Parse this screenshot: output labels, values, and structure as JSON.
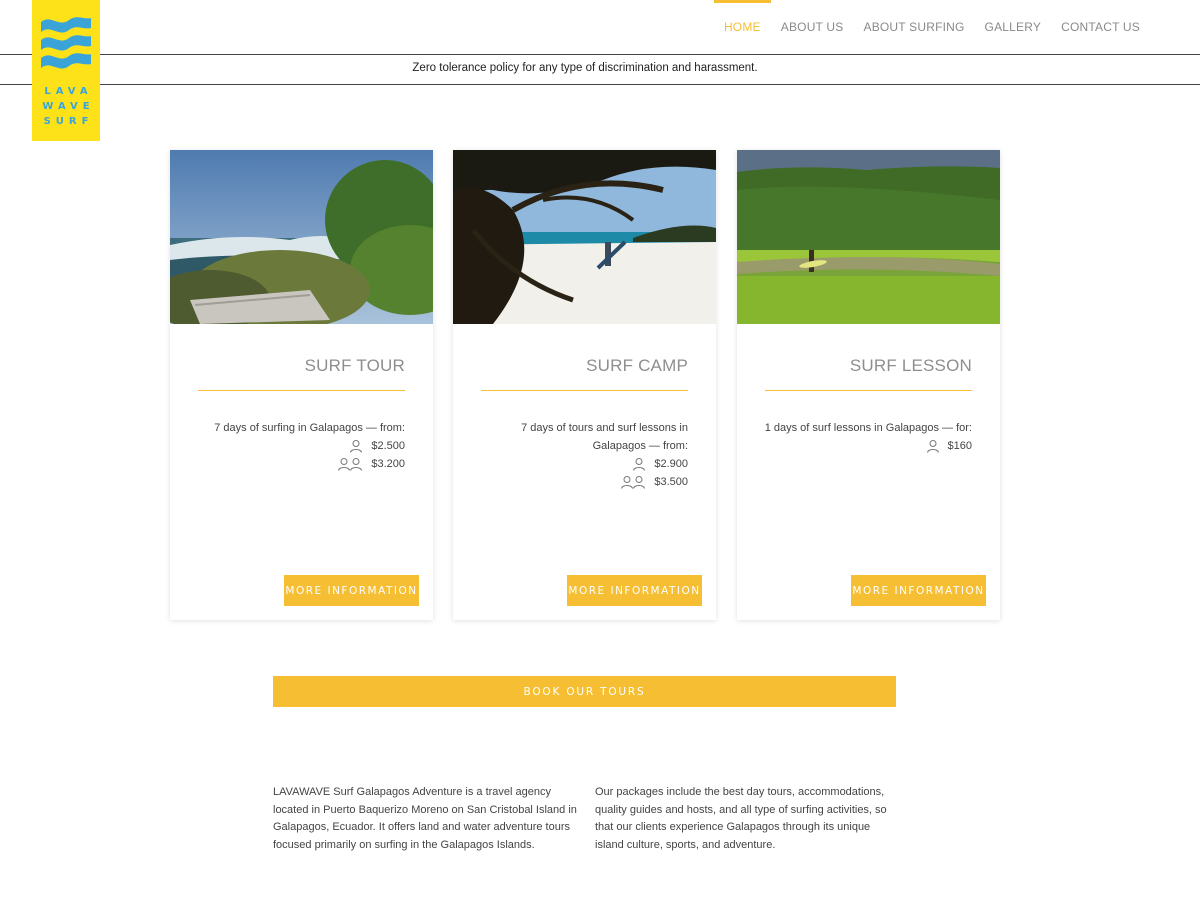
{
  "brand": {
    "logo_line1": "LAVA",
    "logo_line2": "WAVE",
    "logo_line3": "SURF",
    "colors": {
      "accent": "#f6be32",
      "logo_bg": "#fde21a",
      "logo_blue": "#3aa4d8"
    }
  },
  "nav": {
    "items": [
      {
        "label": "HOME",
        "active": true
      },
      {
        "label": "ABOUT US"
      },
      {
        "label": "ABOUT SURFING"
      },
      {
        "label": "GALLERY"
      },
      {
        "label": "CONTACT US"
      }
    ]
  },
  "notice": "Zero tolerance policy for any type of discrimination and harassment.",
  "cards": [
    {
      "title": "SURF TOUR",
      "description": "7 days of surfing in Galapagos — from:",
      "price_single": "$2.500",
      "price_double": "$3.200",
      "button": "MORE INFORMATION"
    },
    {
      "title": "SURF CAMP",
      "description": "7 days of tours and surf lessons in Galapagos — from:",
      "price_single": "$2.900",
      "price_double": "$3.500",
      "button": "MORE INFORMATION"
    },
    {
      "title": "SURF LESSON",
      "description": "1 days of surf lessons in Galapagos — for:",
      "price_single": "$160",
      "button": "MORE INFORMATION"
    }
  ],
  "book_button": "BOOK OUR TOURS",
  "about": {
    "left": "LAVAWAVE Surf Galapagos Adventure is a travel agency located in Puerto Baquerizo Moreno on San Cristobal Island in Galapagos, Ecuador. It offers land and water adventure tours focused primarily on surfing in the Galapagos Islands.",
    "right": "Our packages include the best day tours, accommodations, quality guides and hosts, and all type of surfing activities, so that our clients experience Galapagos through its unique island culture, sports, and adventure."
  }
}
